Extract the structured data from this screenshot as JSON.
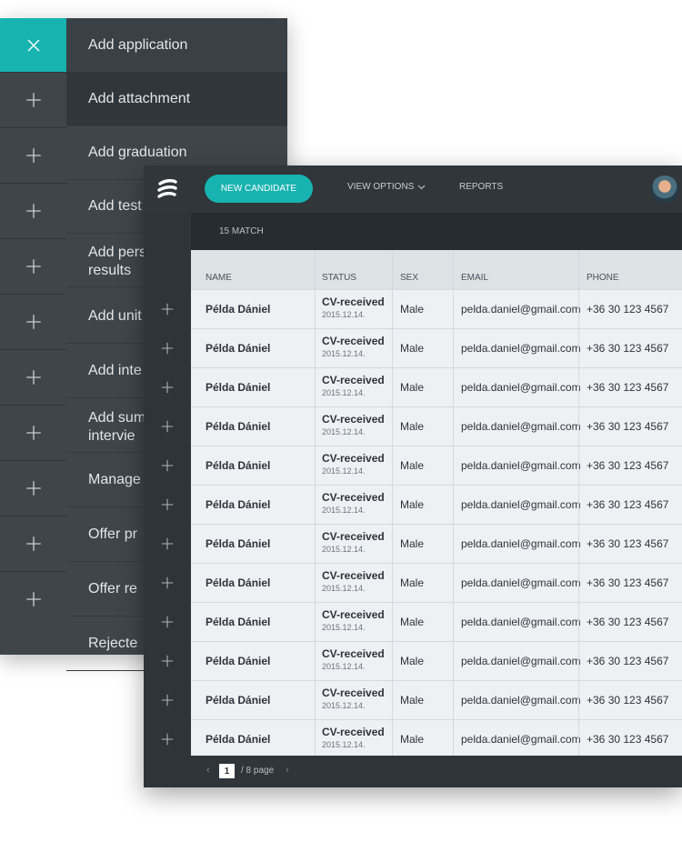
{
  "colors": {
    "accent": "#17b3b0",
    "menu_bg": "#3e464c",
    "table_bg": "#eef1f3"
  },
  "menu": {
    "items": [
      {
        "label": "Add application"
      },
      {
        "label": "Add attachment"
      },
      {
        "label": "Add graduation"
      },
      {
        "label": "Add test"
      },
      {
        "label": "Add pers\nresults"
      },
      {
        "label": "Add unit"
      },
      {
        "label": "Add inte"
      },
      {
        "label": "Add sum\nintervie"
      },
      {
        "label": "Manage"
      },
      {
        "label": "Offer pr"
      },
      {
        "label": "Offer re"
      },
      {
        "label": "Rejecte"
      }
    ]
  },
  "toolbar": {
    "new_candidate": "NEW CANDIDATE",
    "view_options": "VIEW OPTIONS",
    "reports": "REPORTS"
  },
  "match": {
    "label": "15 MATCH"
  },
  "table": {
    "headers": {
      "name": "NAME",
      "status": "STATUS",
      "sex": "SEX",
      "email": "EMAIL",
      "phone": "PHONE"
    },
    "rows": [
      {
        "name": "Példa Dániel",
        "status": "CV-received",
        "date": "2015.12.14.",
        "sex": "Male",
        "email": "pelda.daniel@gmail.com",
        "phone": "+36 30 123 4567"
      },
      {
        "name": "Példa Dániel",
        "status": "CV-received",
        "date": "2015.12.14.",
        "sex": "Male",
        "email": "pelda.daniel@gmail.com",
        "phone": "+36 30 123 4567"
      },
      {
        "name": "Példa Dániel",
        "status": "CV-received",
        "date": "2015.12.14.",
        "sex": "Male",
        "email": "pelda.daniel@gmail.com",
        "phone": "+36 30 123 4567"
      },
      {
        "name": "Példa Dániel",
        "status": "CV-received",
        "date": "2015.12.14.",
        "sex": "Male",
        "email": "pelda.daniel@gmail.com",
        "phone": "+36 30 123 4567"
      },
      {
        "name": "Példa Dániel",
        "status": "CV-received",
        "date": "2015.12.14.",
        "sex": "Male",
        "email": "pelda.daniel@gmail.com",
        "phone": "+36 30 123 4567"
      },
      {
        "name": "Példa Dániel",
        "status": "CV-received",
        "date": "2015.12.14.",
        "sex": "Male",
        "email": "pelda.daniel@gmail.com",
        "phone": "+36 30 123 4567"
      },
      {
        "name": "Példa Dániel",
        "status": "CV-received",
        "date": "2015.12.14.",
        "sex": "Male",
        "email": "pelda.daniel@gmail.com",
        "phone": "+36 30 123 4567"
      },
      {
        "name": "Példa Dániel",
        "status": "CV-received",
        "date": "2015.12.14.",
        "sex": "Male",
        "email": "pelda.daniel@gmail.com",
        "phone": "+36 30 123 4567"
      },
      {
        "name": "Példa Dániel",
        "status": "CV-received",
        "date": "2015.12.14.",
        "sex": "Male",
        "email": "pelda.daniel@gmail.com",
        "phone": "+36 30 123 4567"
      },
      {
        "name": "Példa Dániel",
        "status": "CV-received",
        "date": "2015.12.14.",
        "sex": "Male",
        "email": "pelda.daniel@gmail.com",
        "phone": "+36 30 123 4567"
      },
      {
        "name": "Példa Dániel",
        "status": "CV-received",
        "date": "2015.12.14.",
        "sex": "Male",
        "email": "pelda.daniel@gmail.com",
        "phone": "+36 30 123 4567"
      },
      {
        "name": "Példa Dániel",
        "status": "CV-received",
        "date": "2015.12.14.",
        "sex": "Male",
        "email": "pelda.daniel@gmail.com",
        "phone": "+36 30 123 4567"
      }
    ]
  },
  "pager": {
    "current": "1",
    "total": "/ 8 page"
  },
  "icons": {
    "close": "close-icon",
    "plus": "plus-icon",
    "chevron": "chevron-down-icon",
    "logo": "logo-icon"
  }
}
